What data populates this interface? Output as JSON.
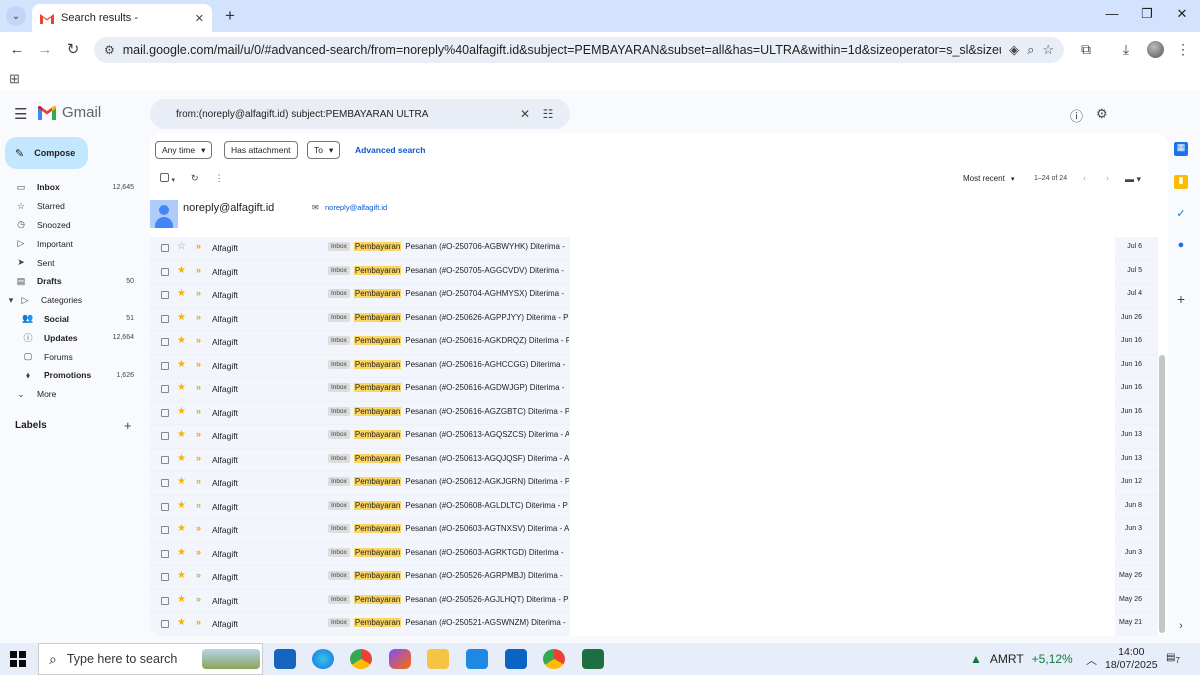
{
  "browser": {
    "tab_title": "Search results - ",
    "url": "mail.google.com/mail/u/0/#advanced-search/from=noreply%40alfagift.id&subject=PEMBAYARAN&subset=all&has=ULTRA&within=1d&sizeoperator=s_sl&sizeunit=s_smb&q...",
    "icons": [
      "chevron-down-icon",
      "gmail-favicon",
      "close-icon",
      "plus-icon",
      "minimize-icon",
      "maximize-icon",
      "close-window-icon",
      "back-icon",
      "forward-icon",
      "reload-icon",
      "site-info-icon",
      "lens-icon",
      "zoom-icon",
      "star-icon",
      "extensions-icon",
      "download-icon",
      "profile-avatar",
      "menu-dots-icon",
      "apps-grid-icon"
    ]
  },
  "gmail": {
    "logo_text": "Gmail",
    "search_query": "from:(noreply@alfagift.id) subject:PEMBAYARAN ULTRA",
    "compose_label": "Compose",
    "nav": [
      {
        "label": "Inbox",
        "count": "12,645",
        "icon": "inbox-icon",
        "bold": true
      },
      {
        "label": "Starred",
        "count": "",
        "icon": "star-icon",
        "bold": false
      },
      {
        "label": "Snoozed",
        "count": "",
        "icon": "clock-icon",
        "bold": false
      },
      {
        "label": "Important",
        "count": "",
        "icon": "label-important-icon",
        "bold": false
      },
      {
        "label": "Sent",
        "count": "",
        "icon": "send-icon",
        "bold": false
      },
      {
        "label": "Drafts",
        "count": "50",
        "icon": "draft-icon",
        "bold": true
      },
      {
        "label": "Categories",
        "count": "",
        "icon": "label-icon",
        "bold": false
      },
      {
        "label": "Social",
        "count": "51",
        "icon": "people-icon",
        "bold": true
      },
      {
        "label": "Updates",
        "count": "12,664",
        "icon": "info-icon",
        "bold": true
      },
      {
        "label": "Forums",
        "count": "",
        "icon": "forum-icon",
        "bold": false
      },
      {
        "label": "Promotions",
        "count": "1,626",
        "icon": "tag-icon",
        "bold": true
      },
      {
        "label": "More",
        "count": "",
        "icon": "chevron-down-icon",
        "bold": false
      }
    ],
    "labels_heading": "Labels",
    "filters": {
      "any_time": "Any time",
      "has_attachment": "Has attachment",
      "to": "To",
      "advanced": "Advanced search"
    },
    "sort_label": "Most recent",
    "count_label": "1–24 of 24",
    "contact": {
      "name": "noreply@alfagift.id",
      "email": "noreply@alfagift.id"
    },
    "inbox_badge": "Inbox",
    "highlight_word": "Pembayaran",
    "emails": [
      {
        "sender": "Alfagift",
        "rest": "Pesanan (#O-250706-AGBWYHK) Diterima - ",
        "date": "Jul 6",
        "starred": false
      },
      {
        "sender": "Alfagift",
        "rest": "Pesanan (#O-250705-AGGCVDV) Diterima - ",
        "date": "Jul 5",
        "starred": true
      },
      {
        "sender": "Alfagift",
        "rest": "Pesanan (#O-250704-AGHMYSX) Diterima - ",
        "date": "Jul 4",
        "starred": true
      },
      {
        "sender": "Alfagift",
        "rest": "Pesanan (#O-250626-AGPPJYY) Diterima - P",
        "date": "Jun 26",
        "starred": true
      },
      {
        "sender": "Alfagift",
        "rest": "Pesanan (#O-250616-AGKDRQZ) Diterima - P",
        "date": "Jun 16",
        "starred": true
      },
      {
        "sender": "Alfagift",
        "rest": "Pesanan (#O-250616-AGHCCGG) Diterima - ",
        "date": "Jun 16",
        "starred": true
      },
      {
        "sender": "Alfagift",
        "rest": "Pesanan (#O-250616-AGDWJGP) Diterima - ",
        "date": "Jun 16",
        "starred": true
      },
      {
        "sender": "Alfagift",
        "rest": "Pesanan (#O-250616-AGZGBTC) Diterima - P",
        "date": "Jun 16",
        "starred": true
      },
      {
        "sender": "Alfagift",
        "rest": "Pesanan (#O-250613-AGQSZCS) Diterima - A",
        "date": "Jun 13",
        "starred": true
      },
      {
        "sender": "Alfagift",
        "rest": "Pesanan (#O-250613-AGQJQSF) Diterima - A",
        "date": "Jun 13",
        "starred": true
      },
      {
        "sender": "Alfagift",
        "rest": "Pesanan (#O-250612-AGKJGRN) Diterima - P",
        "date": "Jun 12",
        "starred": true
      },
      {
        "sender": "Alfagift",
        "rest": "Pesanan (#O-250608-AGLDLTC) Diterima - P",
        "date": "Jun 8",
        "starred": true
      },
      {
        "sender": "Alfagift",
        "rest": "Pesanan (#O-250603-AGTNXSV) Diterima - A",
        "date": "Jun 3",
        "starred": true
      },
      {
        "sender": "Alfagift",
        "rest": "Pesanan (#O-250603-AGRKTGD) Diterima - ",
        "date": "Jun 3",
        "starred": true
      },
      {
        "sender": "Alfagift",
        "rest": "Pesanan (#O-250526-AGRPMBJ) Diterima - ",
        "date": "May 26",
        "starred": true
      },
      {
        "sender": "Alfagift",
        "rest": "Pesanan (#O-250526-AGJLHQT) Diterima - P",
        "date": "May 26",
        "starred": true
      },
      {
        "sender": "Alfagift",
        "rest": "Pesanan (#O-250521-AGSWNZM) Diterima - ",
        "date": "May 21",
        "starred": true
      }
    ],
    "colors": {
      "compose_bg": "#c2e7ff",
      "highlight": "#fcd663",
      "star": "#f4b400",
      "important": "#e8a400",
      "link": "#0b57d0"
    }
  },
  "taskbar": {
    "search_placeholder": "Type here to search",
    "stock_name": "AMRT",
    "stock_change": "+5,12%",
    "time": "14:00",
    "date": "18/07/2025",
    "notif_count": "7",
    "apps": [
      "landscape-widget",
      "app-icon",
      "edge-icon",
      "chrome-icon",
      "copilot-icon",
      "file-explorer-icon",
      "store-icon",
      "outlook-icon",
      "chrome-profile-icon",
      "excel-icon"
    ]
  }
}
